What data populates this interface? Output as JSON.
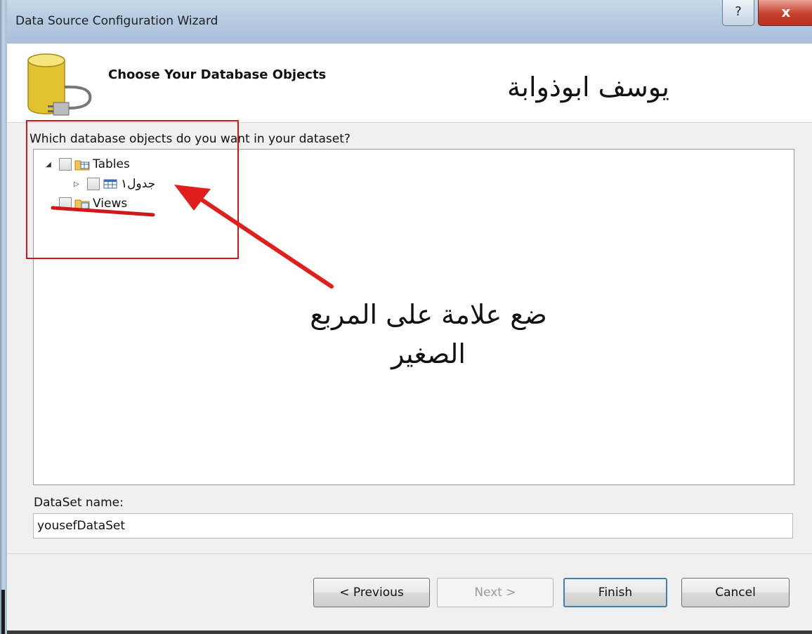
{
  "window": {
    "title": "Data Source Configuration Wizard",
    "help_label": "?",
    "close_label": "x"
  },
  "header": {
    "title": "Choose Your Database Objects",
    "arabic_name": "يوسف ابوذوابة",
    "icon": "database-plug-icon"
  },
  "tree": {
    "prompt": "Which database objects do you want in your dataset?",
    "nodes": [
      {
        "label": "Tables",
        "checked": false,
        "expanded": true,
        "icon": "tables-folder-icon"
      },
      {
        "label": "جدول١",
        "checked": false,
        "expanded": false,
        "icon": "table-icon"
      },
      {
        "label": "Views",
        "checked": false,
        "expanded": false,
        "icon": "views-folder-icon"
      }
    ]
  },
  "dataset": {
    "label": "DataSet name:",
    "value": "yousefDataSet"
  },
  "buttons": {
    "previous": "< Previous",
    "next": "Next >",
    "finish": "Finish",
    "cancel": "Cancel"
  },
  "annotation": {
    "line1": "ضع علامة على المربع",
    "line2": "الصغير",
    "color": "#d01818"
  }
}
